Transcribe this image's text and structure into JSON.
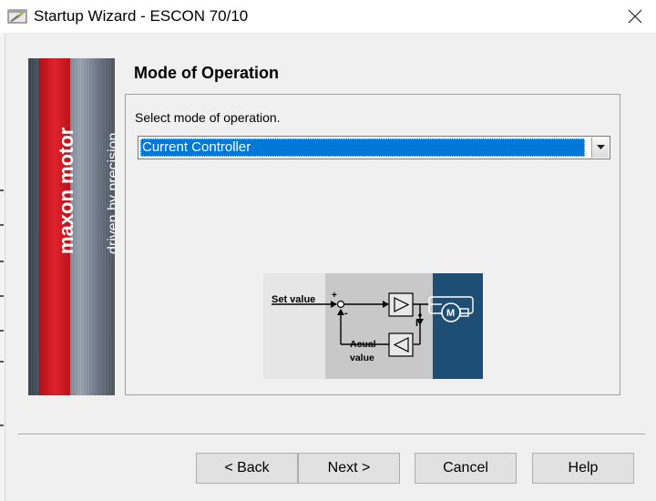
{
  "window": {
    "title": "Startup Wizard - ESCON 70/10",
    "icon": "wizard-app-icon",
    "close_icon": "close-icon"
  },
  "banner": {
    "brand": "maxon motor",
    "tagline": "driven by precision",
    "colors": {
      "red": "#e0222b",
      "steel": "#6b7482"
    }
  },
  "page": {
    "heading": "Mode of Operation",
    "prompt": "Select mode of operation.",
    "mode_select": {
      "value": "Current Controller",
      "icon": "chevron-down-icon"
    }
  },
  "diagram": {
    "set_value_label": "Set value",
    "plus": "+",
    "minus": "-",
    "actual_value_label_1": "Acual",
    "actual_value_label_2": "value",
    "current_label": "I",
    "motor_label": "M",
    "colors": {
      "left": "#e6e6e6",
      "middle": "#c8c8c8",
      "right": "#1f4e74"
    }
  },
  "buttons": {
    "back": "< Back",
    "next": "Next >",
    "cancel": "Cancel",
    "help": "Help"
  },
  "accent_color": "#0078d7"
}
